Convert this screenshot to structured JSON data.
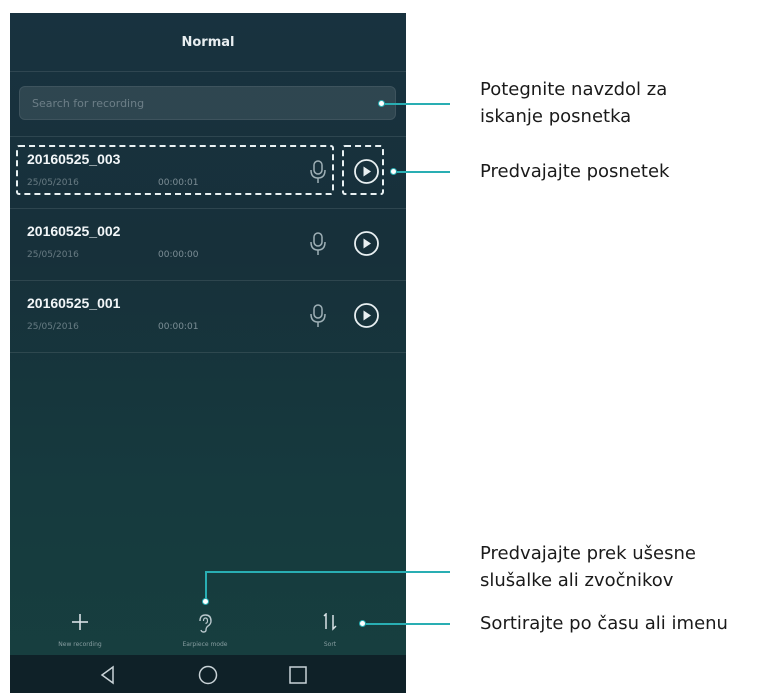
{
  "app": {
    "title": "Normal",
    "search": {
      "placeholder": "Search for recording",
      "value": ""
    },
    "recordings": [
      {
        "name": "20160525_003",
        "date": "25/05/2016",
        "duration": "00:00:01",
        "mic_icon": "microphone-icon",
        "play_icon": "play-icon"
      },
      {
        "name": "20160525_002",
        "date": "25/05/2016",
        "duration": "00:00:00",
        "mic_icon": "microphone-icon",
        "play_icon": "play-icon"
      },
      {
        "name": "20160525_001",
        "date": "25/05/2016",
        "duration": "00:00:01",
        "mic_icon": "microphone-icon",
        "play_icon": "play-icon"
      }
    ],
    "bottom_bar": {
      "new_recording": "New recording",
      "earpiece_mode": "Earpiece mode",
      "sort": "Sort"
    },
    "nav": {
      "back_icon": "back-icon",
      "home_icon": "home-icon",
      "recents_icon": "recents-icon"
    }
  },
  "callouts": {
    "search": [
      "Potegnite navzdol za",
      "iskanje posnetka"
    ],
    "play": "Predvajajte posnetek",
    "earpiece": [
      "Predvajajte prek ušesne",
      "slušalke ali zvočnikov"
    ],
    "sort": "Sortirajte po času ali imenu"
  },
  "colors": {
    "accent": "#29aeb3",
    "screen_bg": "#17303a",
    "text": "#1a1a1a"
  }
}
